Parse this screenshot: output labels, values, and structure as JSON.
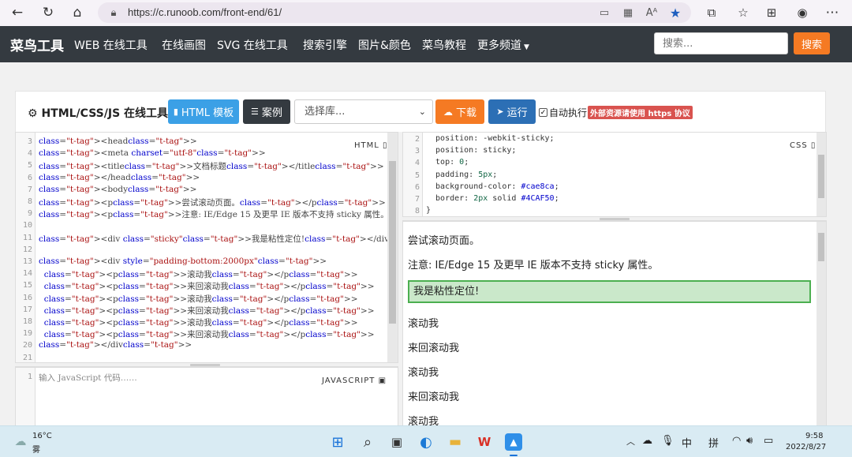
{
  "browser": {
    "url": "https://c.runoob.com/front-end/61/"
  },
  "site": {
    "logo": "菜鸟工具",
    "menu": [
      "WEB 在线工具",
      "在线画图",
      "SVG 在线工具",
      "搜索引擎",
      "图片&颜色",
      "菜鸟教程",
      "更多频道"
    ],
    "search_placeholder": "搜索...",
    "search_button": "搜索"
  },
  "toolbar": {
    "title": "HTML/CSS/JS 在线工具",
    "template_btn": "HTML 模板",
    "case_btn": "案例",
    "lib_select": "选择库...",
    "download_btn": "下载",
    "run_btn": "运行",
    "autorun_label": "自动执行",
    "warning": "外部资源请使用 https 协议"
  },
  "html_editor": {
    "badge": "HTML",
    "lines": [
      {
        "n": "3",
        "text": "<head>"
      },
      {
        "n": "4",
        "text": "<meta charset=\"utf-8\">"
      },
      {
        "n": "5",
        "text": "<title>文档标题</title>"
      },
      {
        "n": "6",
        "text": "</head>"
      },
      {
        "n": "7",
        "text": "<body>"
      },
      {
        "n": "8",
        "text": "<p>尝试滚动页面。</p>"
      },
      {
        "n": "9",
        "text": "<p>注意: IE/Edge 15 及更早 IE 版本不支持 sticky 属性。</p>"
      },
      {
        "n": "10",
        "text": ""
      },
      {
        "n": "11",
        "text": "<div class=\"sticky\">我是粘性定位!</div>"
      },
      {
        "n": "12",
        "text": ""
      },
      {
        "n": "13",
        "text": "<div style=\"padding-bottom:2000px\">"
      },
      {
        "n": "14",
        "text": "  <p>滚动我</p>"
      },
      {
        "n": "15",
        "text": "  <p>来回滚动我</p>"
      },
      {
        "n": "16",
        "text": "  <p>滚动我</p>"
      },
      {
        "n": "17",
        "text": "  <p>来回滚动我</p>"
      },
      {
        "n": "18",
        "text": "  <p>滚动我</p>"
      },
      {
        "n": "19",
        "text": "  <p>来回滚动我</p>"
      },
      {
        "n": "20",
        "text": "</div>"
      },
      {
        "n": "21",
        "text": ""
      }
    ]
  },
  "css_editor": {
    "badge": "CSS",
    "lines": [
      {
        "n": "2",
        "text": "  position: -webkit-sticky;"
      },
      {
        "n": "3",
        "text": "  position: sticky;"
      },
      {
        "n": "4",
        "text": "  top: 0;"
      },
      {
        "n": "5",
        "text": "  padding: 5px;"
      },
      {
        "n": "6",
        "text": "  background-color: #cae8ca;"
      },
      {
        "n": "7",
        "text": "  border: 2px solid #4CAF50;"
      },
      {
        "n": "8",
        "text": "}"
      }
    ]
  },
  "js_editor": {
    "badge": "JAVASCRIPT",
    "line_no": "1",
    "placeholder": "输入 JavaScript 代码……"
  },
  "preview": {
    "p1": "尝试滚动页面。",
    "p2": "注意: IE/Edge 15 及更早 IE 版本不支持 sticky 属性。",
    "sticky": "我是粘性定位!",
    "items": [
      "滚动我",
      "来回滚动我",
      "滚动我",
      "来回滚动我",
      "滚动我"
    ]
  },
  "taskbar": {
    "weather_temp": "16°C",
    "weather_desc": "雾",
    "ime1": "中",
    "ime2": "拼",
    "time": "9:58",
    "date": "2022/8/27"
  },
  "colors": {
    "header_bg": "#343a40",
    "orange": "#f57a23",
    "blue": "#3ba0e6",
    "dark": "#343a40",
    "run_blue": "#2c6fb5",
    "sticky_bg": "#cae8ca",
    "sticky_border": "#4CAF50"
  }
}
